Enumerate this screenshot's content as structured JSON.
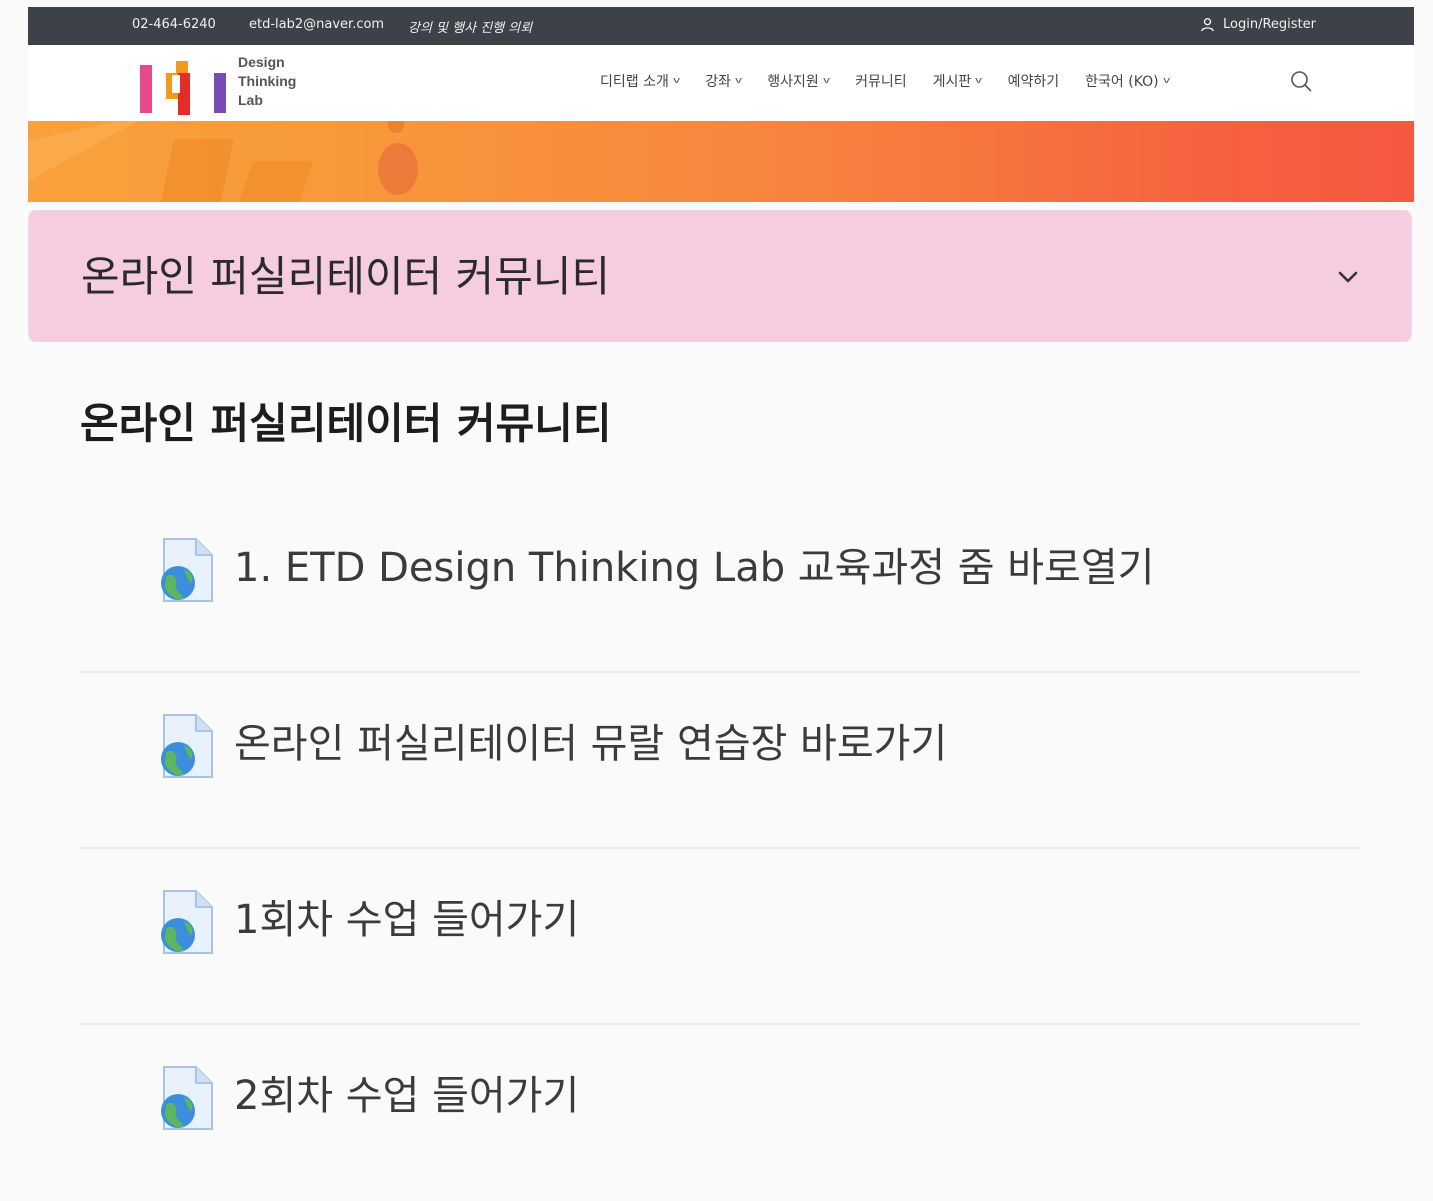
{
  "topbar": {
    "phone": "02-464-6240",
    "email": "etd-lab2@naver.com",
    "request": "강의 및 행사 진행 의뢰",
    "login": "Login/Register"
  },
  "logo": {
    "line1": "Design",
    "line2": "Thinking",
    "line3": "Lab"
  },
  "nav": {
    "items": [
      {
        "label": "디티랩 소개",
        "has_dropdown": true
      },
      {
        "label": "강좌",
        "has_dropdown": true
      },
      {
        "label": "행사지원",
        "has_dropdown": true
      },
      {
        "label": "커뮤니티",
        "has_dropdown": false
      },
      {
        "label": "게시판",
        "has_dropdown": true
      },
      {
        "label": "예약하기",
        "has_dropdown": false
      },
      {
        "label": "한국어 (KO)",
        "has_dropdown": true
      }
    ],
    "dropdown_glyph": "v"
  },
  "section": {
    "title": "온라인 퍼실리테이터 커뮤니티",
    "collapse_icon": "chevron-down-icon"
  },
  "page": {
    "heading": "온라인 퍼실리테이터 커뮤니티"
  },
  "activities": [
    {
      "label": "1. ETD Design Thinking Lab 교육과정 줌 바로열기",
      "icon": "url-globe-icon"
    },
    {
      "label": "온라인 퍼실리테이터 뮤랄 연습장 바로가기",
      "icon": "url-globe-icon"
    },
    {
      "label": "1회차 수업 들어가기",
      "icon": "url-globe-icon"
    },
    {
      "label": "2회차 수업 들어가기",
      "icon": "url-globe-icon"
    }
  ],
  "colors": {
    "topbar": "#3c4247",
    "section_bg": "#f5cce0",
    "banner_start": "#f9a13d",
    "banner_end": "#f4583f"
  }
}
